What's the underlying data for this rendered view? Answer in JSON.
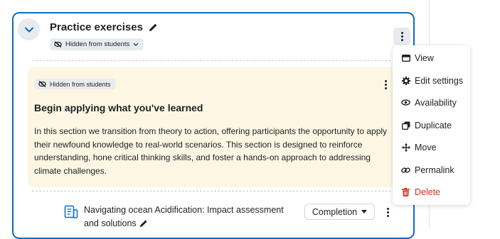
{
  "section": {
    "title": "Practice exercises",
    "visibility_badge": "Hidden from students"
  },
  "summary": {
    "visibility_badge": "Hidden from students",
    "title": "Begin applying what you've learned",
    "text": "In this section we transition from theory to action, offering participants the opportunity to apply their newfound knowledge to real-world scenarios. This section is designed to reinforce understanding, hone critical thinking skills, and foster a hands-on approach to addressing climate challenges."
  },
  "activity": {
    "name": "Navigating ocean Acidification: Impact assessment and solutions",
    "completion_label": "Completion"
  },
  "menu": {
    "items": [
      {
        "label": "View",
        "icon": "view-icon"
      },
      {
        "label": "Edit settings",
        "icon": "gear-icon"
      },
      {
        "label": "Availability",
        "icon": "eye-icon"
      },
      {
        "label": "Duplicate",
        "icon": "copy-icon"
      },
      {
        "label": "Move",
        "icon": "move-arrows-icon"
      },
      {
        "label": "Permalink",
        "icon": "link-icon"
      },
      {
        "label": "Delete",
        "icon": "trash-icon"
      }
    ]
  },
  "colors": {
    "accent": "#0f6cbf",
    "summary_bg": "#fdf6e3",
    "danger": "#ca3120"
  }
}
